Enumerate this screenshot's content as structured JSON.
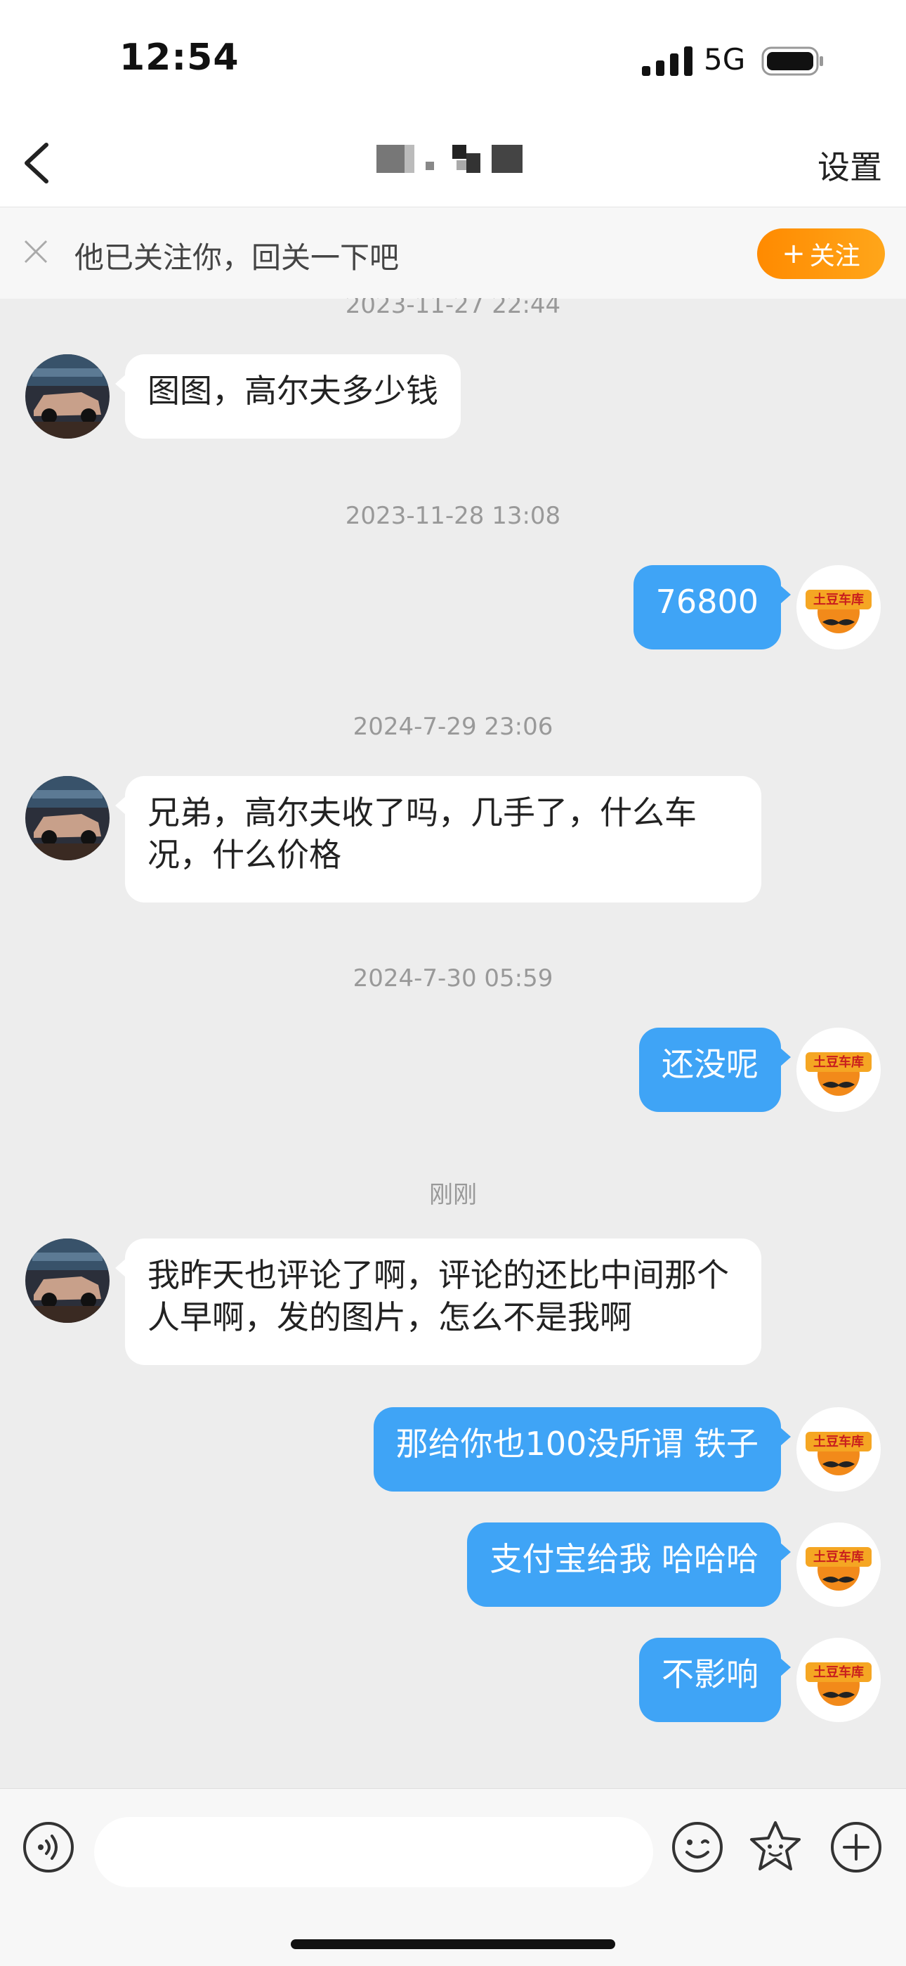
{
  "status_bar": {
    "time": "12:54",
    "network": "5G"
  },
  "header": {
    "title": "",
    "settings_label": "设置"
  },
  "follow_banner": {
    "text": "他已关注你，回关一下吧",
    "button_label": "关注",
    "button_icon": "+"
  },
  "messages": [
    {
      "timestamp": "2023-11-27 22:44",
      "from": "other",
      "text": "图图，高尔夫多少钱"
    },
    {
      "timestamp": "2023-11-28 13:08",
      "from": "me",
      "text": "76800"
    },
    {
      "timestamp": "2024-7-29 23:06",
      "from": "other",
      "text": "兄弟，高尔夫收了吗，几手了，什么车况，什么价格"
    },
    {
      "timestamp": "2024-7-30 05:59",
      "from": "me",
      "text": "还没呢"
    },
    {
      "timestamp": "刚刚",
      "from": "other",
      "text": "我昨天也评论了啊，评论的还比中间那个人早啊，发的图片，怎么不是我啊"
    },
    {
      "from": "me",
      "text": "那给你也100没所谓 铁子"
    },
    {
      "from": "me",
      "text": "支付宝给我 哈哈哈"
    },
    {
      "from": "me",
      "text": "不影响"
    }
  ],
  "self_avatar_text": "土豆车库",
  "input_bar": {
    "value": "",
    "placeholder": ""
  },
  "colors": {
    "accent_blue": "#3fa4f6",
    "follow_orange": "#ff8a00",
    "background": "#ededed"
  }
}
